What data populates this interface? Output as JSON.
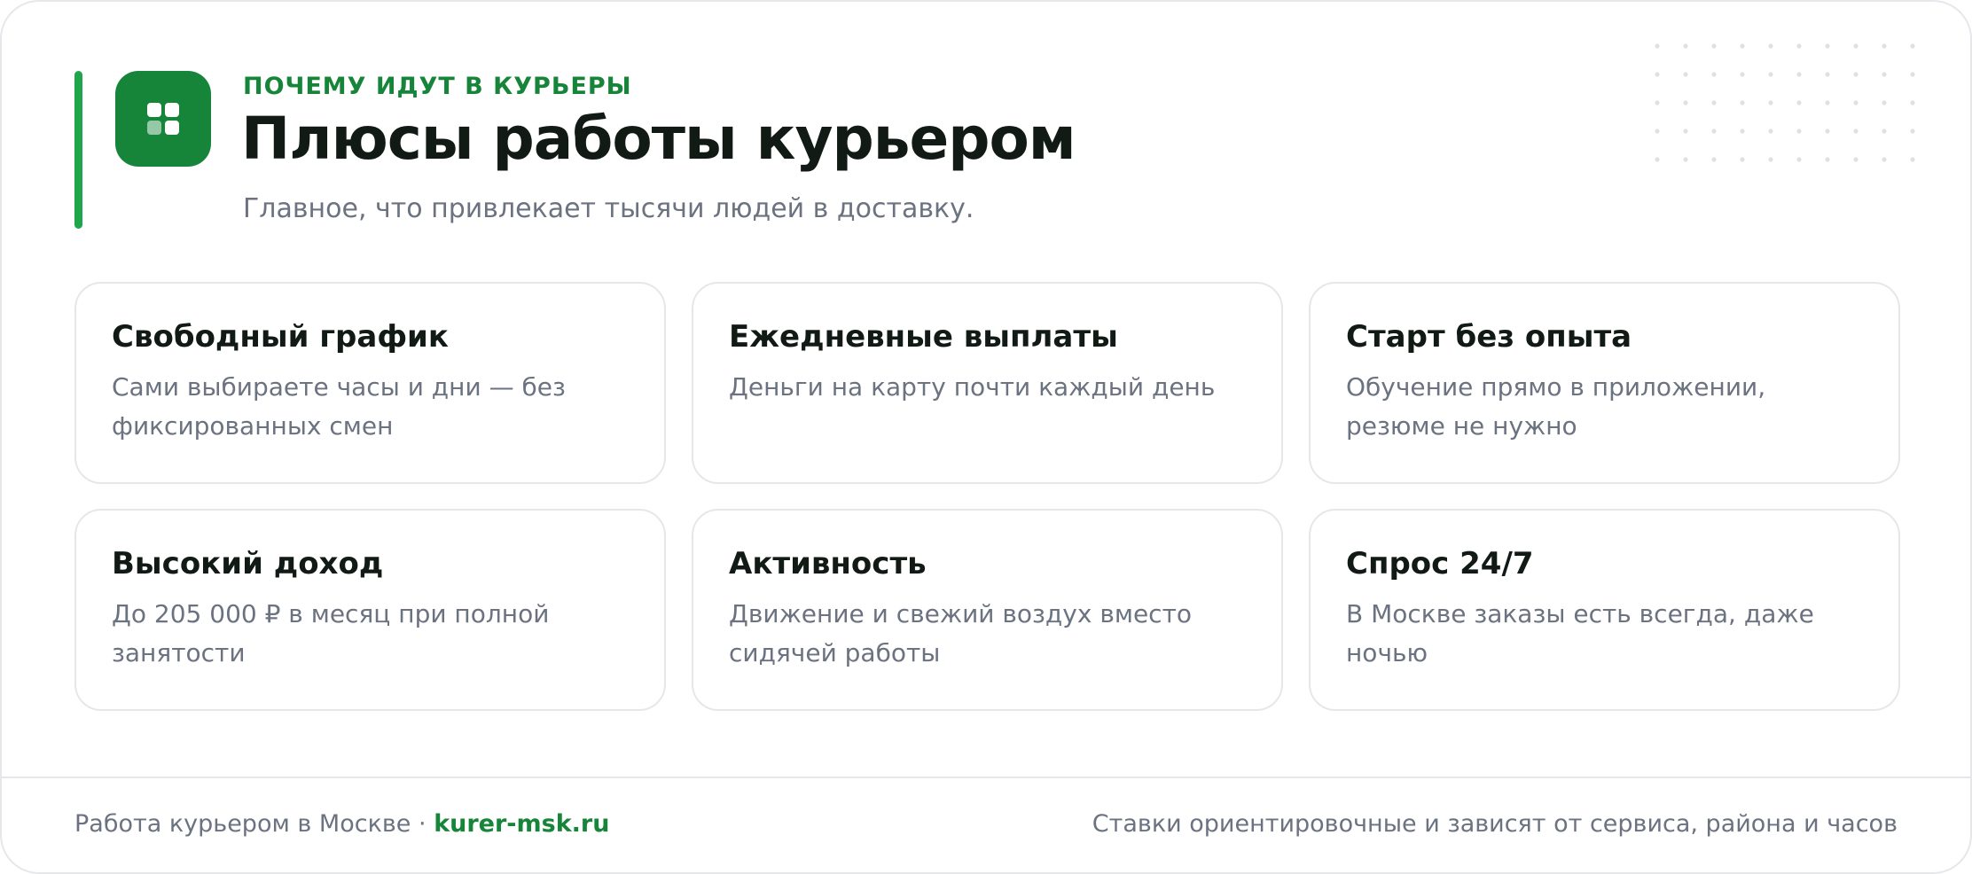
{
  "header": {
    "eyebrow": "ПОЧЕМУ ИДУТ В КУРЬЕРЫ",
    "title": "Плюсы работы курьером",
    "subtitle": "Главное, что привлекает тысячи людей в доставку.",
    "logo_icon": "grid-icon"
  },
  "benefits": [
    {
      "title": "Свободный график",
      "desc": "Сами выбираете часы и дни — без фиксированных смен"
    },
    {
      "title": "Ежедневные выплаты",
      "desc": "Деньги на карту почти каждый день"
    },
    {
      "title": "Старт без опыта",
      "desc": "Обучение прямо в приложении, резюме не нужно"
    },
    {
      "title": "Высокий доход",
      "desc": "До 205 000 ₽ в месяц при полной занятости"
    },
    {
      "title": "Активность",
      "desc": "Движение и свежий воздух вместо сидячей работы"
    },
    {
      "title": "Спрос 24/7",
      "desc": "В Москве заказы есть всегда, даже ночью"
    }
  ],
  "footer": {
    "left_text": "Работа курьером в Москве",
    "separator": "·",
    "link": "kurer-msk.ru",
    "right_text": "Ставки ориентировочные и зависят от сервиса, района и часов"
  },
  "colors": {
    "brand": "#16853a",
    "accent": "#1fa64a",
    "text": "#111a14",
    "muted": "#6b7280",
    "border": "#e5e7eb"
  }
}
